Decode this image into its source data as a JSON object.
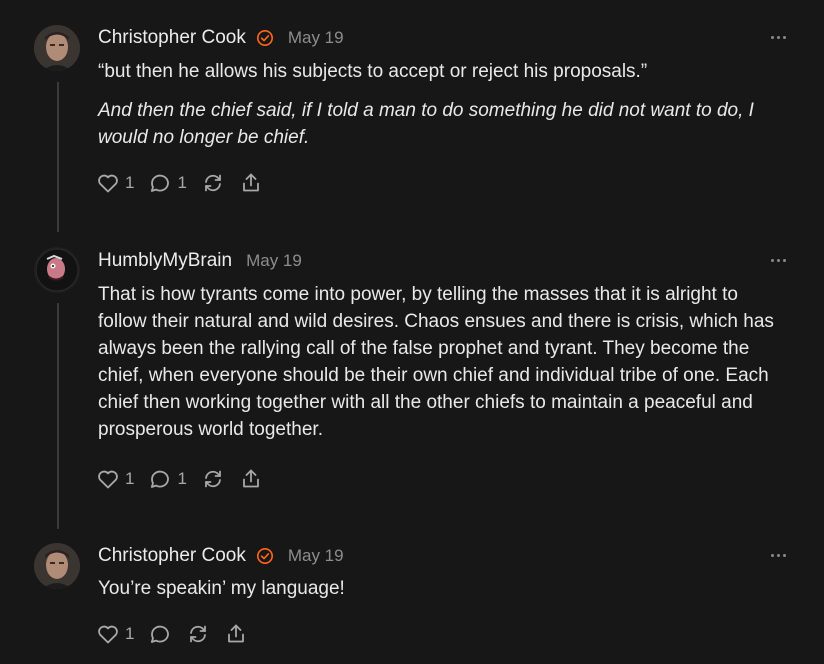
{
  "comments": [
    {
      "author": "Christopher Cook",
      "verified": true,
      "date": "May 19",
      "paragraphs": [
        "“but then he allows his subjects to accept or reject his proposals.”",
        "And then the chief said, if I told a man to do something he did not want to do, I would no longer be chief."
      ],
      "likes": "1",
      "replies": "1",
      "icons": {
        "like": "heart-icon",
        "reply": "comment-icon",
        "restack": "restack-icon",
        "share": "share-icon",
        "more": "more-icon"
      }
    },
    {
      "author": "HumblyMyBrain",
      "verified": false,
      "date": "May 19",
      "paragraphs": [
        "That is how tyrants come into power, by telling the masses that it is alright to follow their natural and wild desires. Chaos ensues and there is crisis, which has always been the rallying call of the false prophet and tyrant. They become the chief, when everyone should be their own chief and individual tribe of one. Each chief then working together with all the other chiefs to maintain a peaceful and prosperous world together."
      ],
      "likes": "1",
      "replies": "1"
    },
    {
      "author": "Christopher Cook",
      "verified": true,
      "date": "May 19",
      "paragraphs": [
        "You’re speakin’ my language!"
      ],
      "likes": "1",
      "replies": ""
    }
  ],
  "colors": {
    "background": "#171717",
    "verified": "#ff6719",
    "muted": "#8d8d8d"
  }
}
